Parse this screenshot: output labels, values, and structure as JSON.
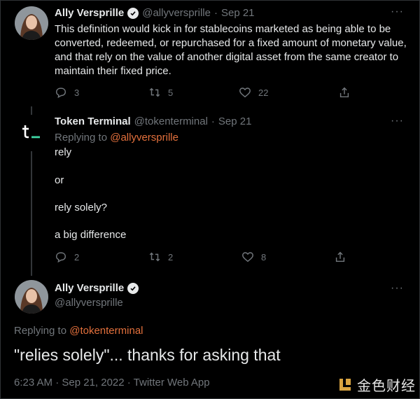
{
  "tweet1": {
    "name": "Ally Versprille",
    "handle": "@allyversprille",
    "sep": "·",
    "date": "Sep 21",
    "more": "···",
    "text": "This definition would kick in for stablecoins marketed as being able to be converted, redeemed, or repurchased for a fixed amount of monetary value, and that rely on the value of another digital asset from the same creator to maintain their fixed price.",
    "actions": {
      "replies": "3",
      "retweets": "5",
      "likes": "22"
    }
  },
  "tweet2": {
    "avatar_text": "t_",
    "name": "Token Terminal",
    "handle": "@tokenterminal",
    "sep": "·",
    "date": "Sep 21",
    "more": "···",
    "replying_prefix": "Replying to ",
    "replying_to": "@allyversprille",
    "paragraphs": [
      "rely",
      "or",
      "rely solely?",
      "a big difference"
    ],
    "actions": {
      "replies": "2",
      "retweets": "2",
      "likes": "8"
    }
  },
  "tweet3": {
    "name": "Ally Versprille",
    "handle": "@allyversprille",
    "more": "···",
    "replying_prefix": "Replying to ",
    "replying_to": "@tokenterminal",
    "text": "\"relies solely\"... thanks for asking that",
    "meta": "6:23 AM · Sep 21, 2022 · Twitter Web App"
  },
  "watermark": {
    "text": "金色财经"
  },
  "colors": {
    "link": "#e3703c",
    "muted": "#71767b",
    "text": "#e7e9ea",
    "accent_green": "#3fd6a4"
  }
}
